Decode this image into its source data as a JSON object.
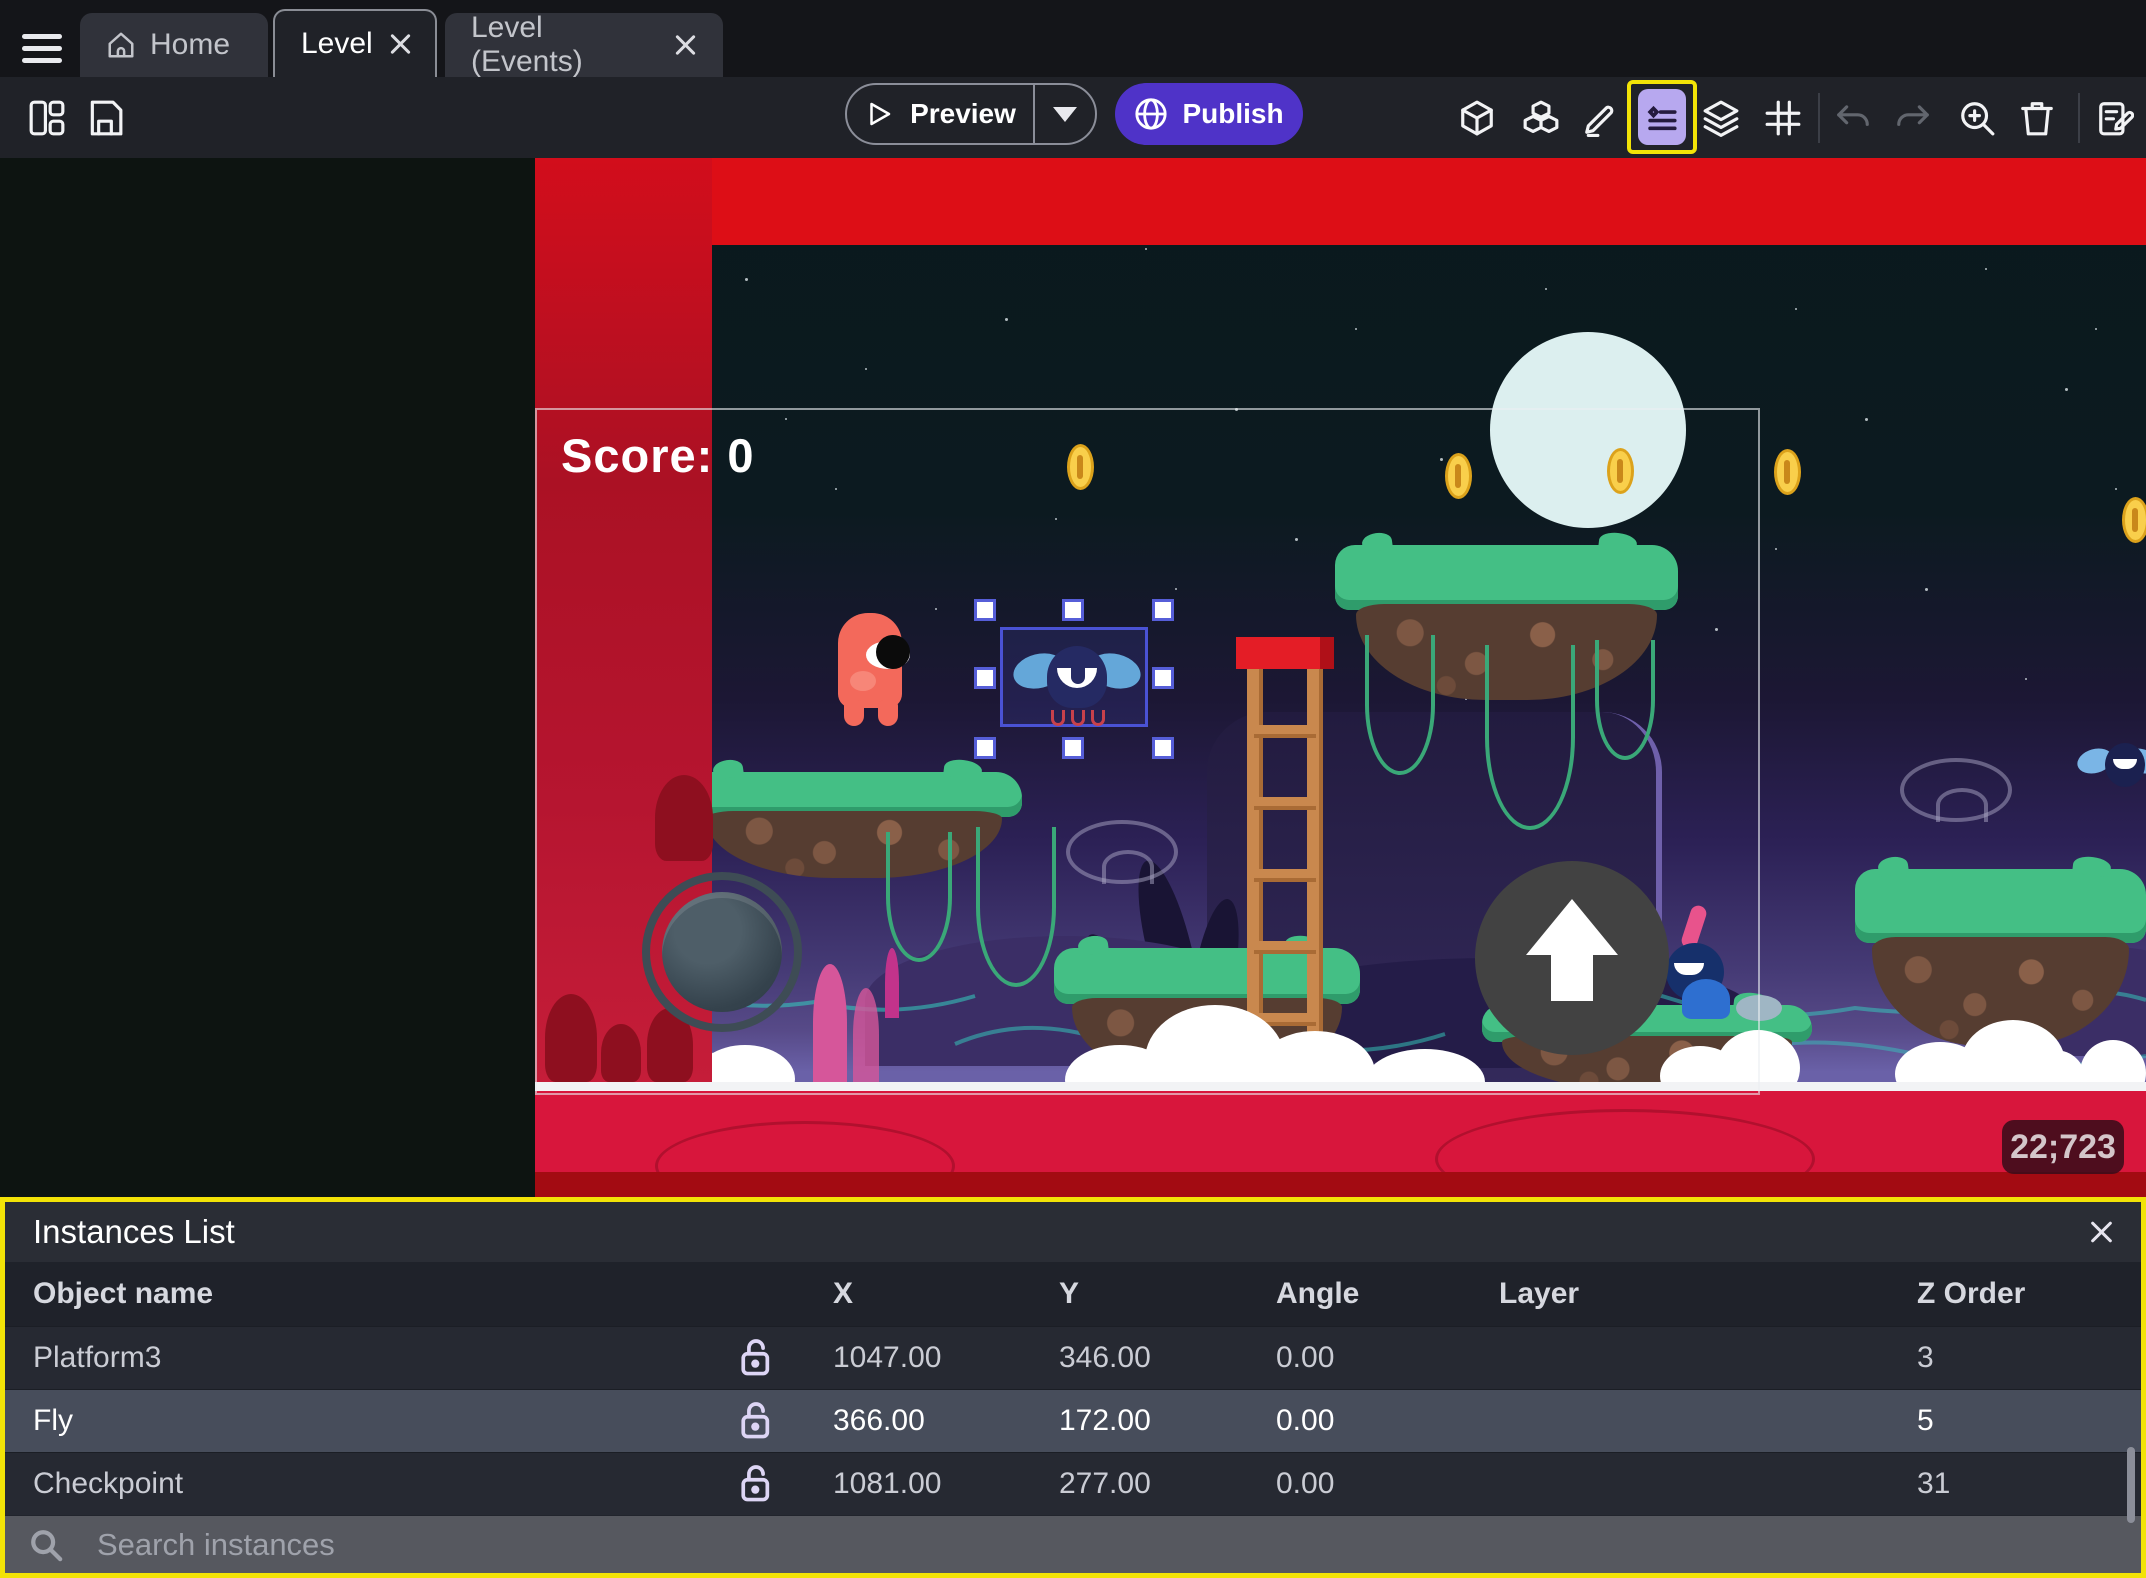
{
  "tabs": {
    "home": "Home",
    "level": "Level",
    "level_events": "Level (Events)"
  },
  "toolbar": {
    "preview_label": "Preview",
    "publish_label": "Publish"
  },
  "scene": {
    "score_text": "Score: 0",
    "coords_badge": "22;723"
  },
  "instances_panel": {
    "title": "Instances List",
    "columns": [
      "Object name",
      "X",
      "Y",
      "Angle",
      "Layer",
      "Z Order"
    ],
    "rows": [
      {
        "name": "Platform3",
        "x": "1047.00",
        "y": "346.00",
        "angle": "0.00",
        "layer": "",
        "z": "3",
        "selected": false
      },
      {
        "name": "Fly",
        "x": "366.00",
        "y": "172.00",
        "angle": "0.00",
        "layer": "",
        "z": "5",
        "selected": true
      },
      {
        "name": "Checkpoint",
        "x": "1081.00",
        "y": "277.00",
        "angle": "0.00",
        "layer": "",
        "z": "31",
        "selected": false
      }
    ],
    "search_placeholder": "Search instances"
  },
  "colors": {
    "accent_purple": "#4f33c8",
    "highlight_yellow": "#f2e307",
    "selected_row": "#474d5b",
    "instances_icon_bg": "#b7a8ef",
    "red_overlay": "#c11226"
  }
}
